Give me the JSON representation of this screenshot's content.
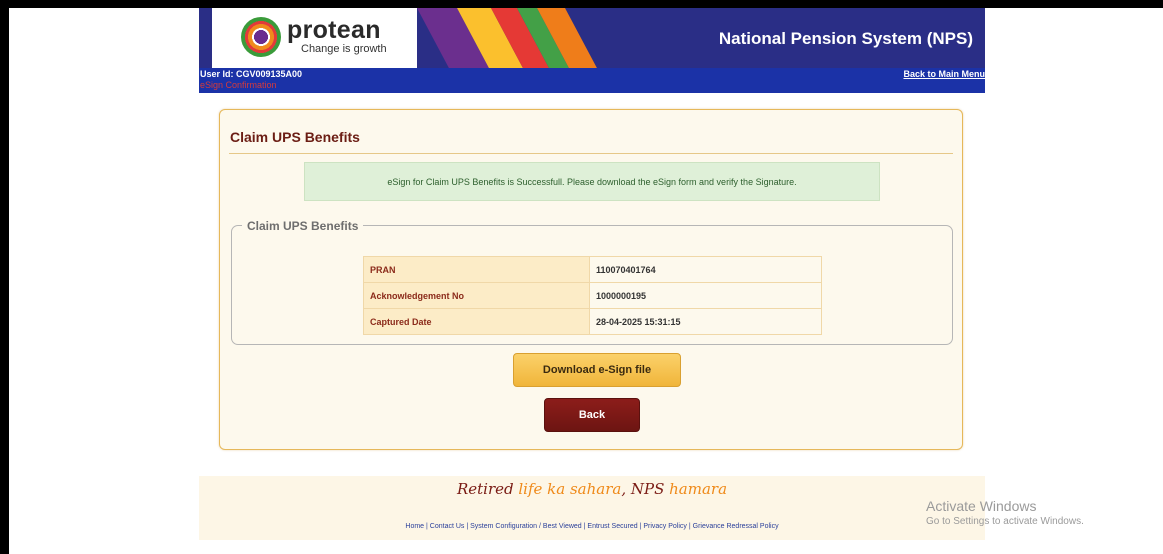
{
  "header": {
    "logo_text": "protean",
    "logo_tagline": "Change is growth",
    "system_title": "National Pension System (NPS)"
  },
  "userbar": {
    "user_id": "User Id: CGV009135A00",
    "esign_link": "eSign Confirmation",
    "back_to_main": "Back to Main Menu"
  },
  "panel": {
    "title": "Claim UPS Benefits",
    "success_message": "eSign for Claim UPS Benefits is Successfull. Please download the eSign form and verify the Signature.",
    "fieldset_legend": "Claim UPS Benefits",
    "rows": [
      {
        "label": "PRAN",
        "value": "110070401764"
      },
      {
        "label": "Acknowledgement No",
        "value": "1000000195"
      },
      {
        "label": "Captured Date",
        "value": "28-04-2025 15:31:15"
      }
    ],
    "download_button": "Download e-Sign file",
    "back_button": "Back"
  },
  "footer": {
    "slogan_parts": [
      "Retired ",
      "life ka sahara",
      ", NPS ",
      "hamara"
    ],
    "links": [
      "Home",
      "Contact Us",
      "System Configuration / Best Viewed",
      "Entrust Secured",
      "Privacy Policy",
      "Grievance Redressal Policy"
    ],
    "separator": " | "
  },
  "watermark": {
    "title": "Activate Windows",
    "subtitle": "Go to Settings to activate Windows."
  },
  "colors": {
    "banner": "#2a2e86",
    "userbar": "#1b32a7",
    "panel_border": "#e6b85a",
    "title": "#6b1d14",
    "download_button": "#f0b53a",
    "back_button": "#7a1a16",
    "stripes": [
      "#6b2f8e",
      "#fbc02d",
      "#e53935",
      "#43a047",
      "#ef7d1a"
    ]
  }
}
